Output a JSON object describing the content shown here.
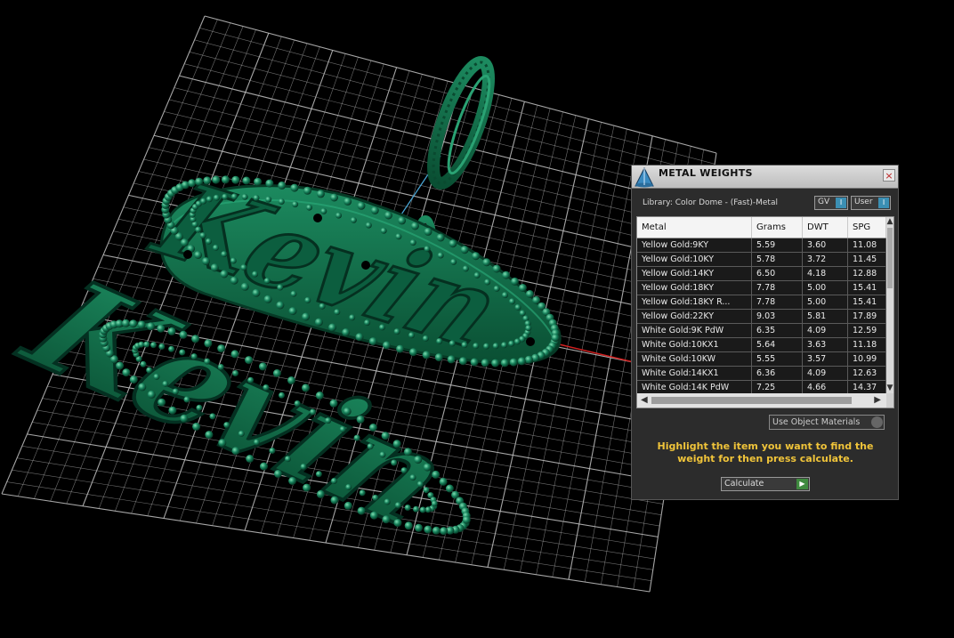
{
  "panel": {
    "title": "METAL WEIGHTS",
    "close": "×",
    "library": "Library: Color Dome - (Fast)-Metal",
    "toggle_gv": "GV",
    "toggle_user": "User",
    "toggle_knob": "I",
    "columns": [
      "Metal",
      "Grams",
      "DWT",
      "SPG"
    ],
    "rows": [
      [
        "Yellow Gold:9KY",
        "5.59",
        "3.60",
        "11.08"
      ],
      [
        "Yellow Gold:10KY",
        "5.78",
        "3.72",
        "11.45"
      ],
      [
        "Yellow Gold:14KY",
        "6.50",
        "4.18",
        "12.88"
      ],
      [
        "Yellow Gold:18KY",
        "7.78",
        "5.00",
        "15.41"
      ],
      [
        "Yellow Gold:18KY R...",
        "7.78",
        "5.00",
        "15.41"
      ],
      [
        "Yellow Gold:22KY",
        "9.03",
        "5.81",
        "17.89"
      ],
      [
        "White Gold:9K PdW",
        "6.35",
        "4.09",
        "12.59"
      ],
      [
        "White Gold:10KX1",
        "5.64",
        "3.63",
        "11.18"
      ],
      [
        "White Gold:10KW",
        "5.55",
        "3.57",
        "10.99"
      ],
      [
        "White Gold:14KX1",
        "6.36",
        "4.09",
        "12.63"
      ],
      [
        "White Gold:14K PdW",
        "7.25",
        "4.66",
        "14.37"
      ]
    ],
    "use_object_materials": "Use Object Materials",
    "hint": "Highlight the item you want to find the weight for then press calculate.",
    "calculate": "Calculate"
  },
  "scene": {
    "model_text_top": "Kevin",
    "model_text_bottom": "Kevin",
    "model_color": "#0d6b47",
    "grid_color": "#b8b8b8"
  }
}
